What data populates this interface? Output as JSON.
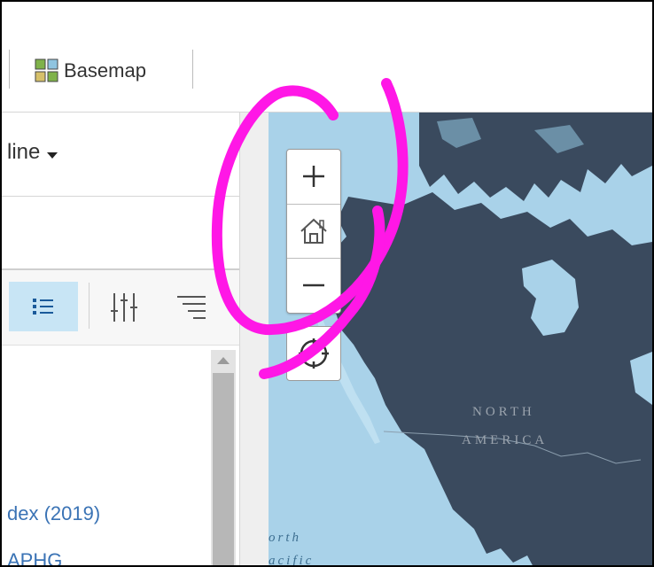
{
  "toolbar": {
    "basemap_label": "Basemap",
    "basemap_icon": "basemap-grid-icon",
    "accent_color": "#7fb24a"
  },
  "panel": {
    "dropdown_label": "line",
    "tools": [
      "list-icon",
      "adjust-icon",
      "filter-icon"
    ],
    "layers": [
      {
        "label": "dex (2019)"
      },
      {
        "label": "APHG"
      }
    ]
  },
  "map": {
    "labels": {
      "north_america_line1": "NORTH",
      "north_america_line2": "AMERICA",
      "ocean_line1": "orth",
      "ocean_line2": "acific"
    },
    "controls": {
      "zoom_in": "+",
      "zoom_out": "−",
      "home_icon": "home-icon",
      "locate_icon": "locate-icon"
    },
    "colors": {
      "water": "#a9d2e9",
      "land": "#3a4a5e",
      "annotation": "#ff17e6"
    }
  }
}
